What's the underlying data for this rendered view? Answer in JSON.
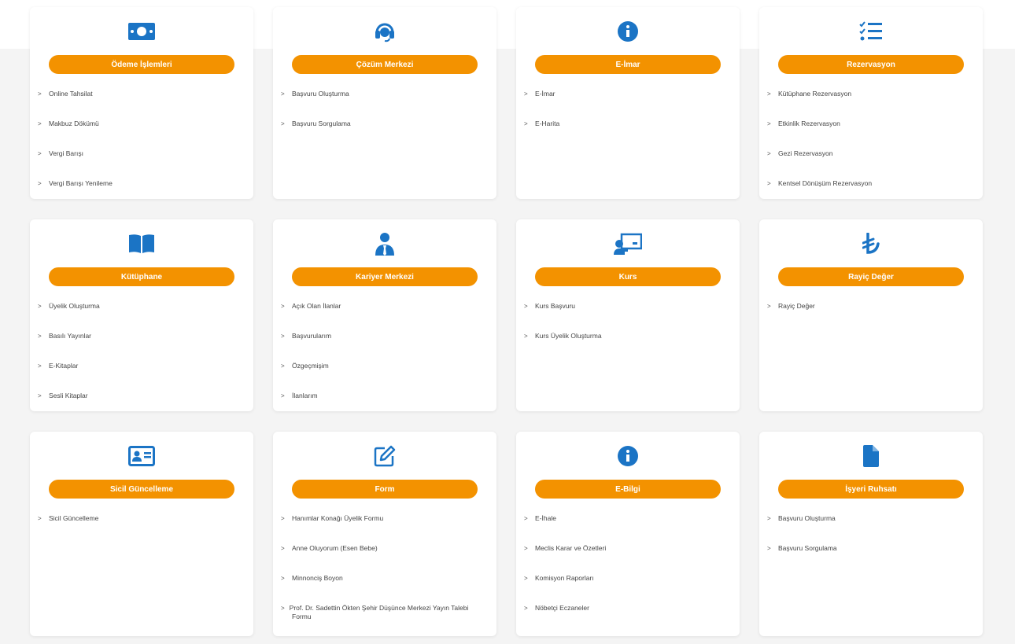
{
  "colors": {
    "accent": "#f39200",
    "icon": "#1b74c5",
    "background": "#f4f4f4"
  },
  "cards": [
    {
      "icon": "money-icon",
      "title": "Ödeme İşlemleri",
      "items": [
        "Online Tahsilat",
        "Makbuz Dökümü",
        "Vergi Barışı",
        "Vergi Barışı Yenileme"
      ]
    },
    {
      "icon": "headset-icon",
      "title": "Çözüm Merkezi",
      "items": [
        "Başvuru Oluşturma",
        "Başvuru Sorgulama"
      ]
    },
    {
      "icon": "info-icon",
      "title": "E-İmar",
      "items": [
        "E-İmar",
        "E-Harita"
      ]
    },
    {
      "icon": "checklist-icon",
      "title": "Rezervasyon",
      "items": [
        "Kütüphane Rezervasyon",
        "Etkinlik Rezervasyon",
        "Gezi Rezervasyon",
        "Kentsel Dönüşüm Rezervasyon"
      ]
    },
    {
      "icon": "book-icon",
      "title": "Kütüphane",
      "items": [
        "Üyelik Oluşturma",
        "Basılı Yayınlar",
        "E-Kitaplar",
        "Sesli Kitaplar"
      ]
    },
    {
      "icon": "user-tie-icon",
      "title": "Kariyer Merkezi",
      "items": [
        "Açık Olan İlanlar",
        "Başvurularım",
        "Özgeçmişim",
        "İlanlarım"
      ]
    },
    {
      "icon": "teacher-board-icon",
      "title": "Kurs",
      "items": [
        "Kurs Başvuru",
        "Kurs Üyelik Oluşturma"
      ]
    },
    {
      "icon": "lira-icon",
      "title": "Rayiç Değer",
      "items": [
        "Rayiç Değer"
      ]
    },
    {
      "icon": "id-card-icon",
      "title": "Sicil Güncelleme",
      "items": [
        "Sicil Güncelleme"
      ]
    },
    {
      "icon": "edit-icon",
      "title": "Form",
      "items": [
        "Hanımlar Konağı Üyelik Formu",
        "Anne Oluyorum (Esen Bebe)",
        "Minnonciş Boyon",
        "Prof. Dr. Sadettin Ökten Şehir Düşünce Merkezi Yayın Talebi Formu"
      ]
    },
    {
      "icon": "info-icon",
      "title": "E-Bilgi",
      "items": [
        "E-İhale",
        "Meclis Karar ve Özetleri",
        "Komisyon Raporları",
        "Nöbetçi Eczaneler"
      ]
    },
    {
      "icon": "file-icon",
      "title": "İşyeri Ruhsatı",
      "items": [
        "Başvuru Oluşturma",
        "Başvuru Sorgulama"
      ]
    }
  ]
}
